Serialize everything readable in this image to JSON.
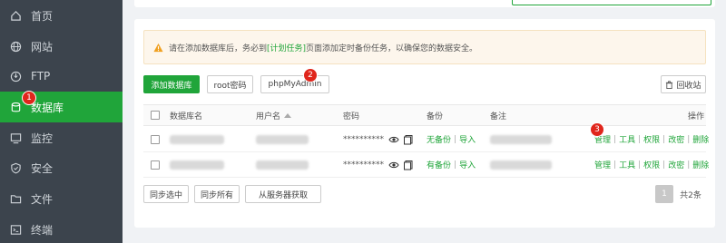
{
  "sidebar": {
    "items": [
      {
        "label": "首页",
        "icon": "home-icon"
      },
      {
        "label": "网站",
        "icon": "globe-icon"
      },
      {
        "label": "FTP",
        "icon": "ftp-icon"
      },
      {
        "label": "数据库",
        "icon": "database-icon",
        "active": true,
        "badge": "1"
      },
      {
        "label": "监控",
        "icon": "monitor-icon"
      },
      {
        "label": "安全",
        "icon": "shield-icon"
      },
      {
        "label": "文件",
        "icon": "folder-icon"
      },
      {
        "label": "终端",
        "icon": "terminal-icon"
      }
    ]
  },
  "notice": {
    "prefix": "请在添加数据库后，务必到",
    "link": "[计划任务]",
    "suffix": "页面添加定时备份任务，以确保您的数据安全。"
  },
  "toolbar": {
    "add_db": "添加数据库",
    "root_pwd": "root密码",
    "phpmyadmin": "phpMyAdmin",
    "phpmyadmin_badge": "2",
    "recycle_bin": "回收站"
  },
  "table": {
    "headers": {
      "name": "数据库名",
      "user": "用户名",
      "password": "密码",
      "backup": "备份",
      "note": "备注",
      "actions": "操作"
    },
    "rows": [
      {
        "password": "**********",
        "backup_status": "无备份",
        "import": "导入",
        "actions": [
          "管理",
          "工具",
          "权限",
          "改密",
          "删除"
        ],
        "badge": "3"
      },
      {
        "password": "**********",
        "backup_status": "有备份",
        "import": "导入",
        "actions": [
          "管理",
          "工具",
          "权限",
          "改密",
          "删除"
        ]
      }
    ]
  },
  "footer": {
    "sync_selected": "同步选中",
    "sync_all": "同步所有",
    "fetch_server": "从服务器获取",
    "current_page": "1",
    "total": "共2条"
  },
  "colors": {
    "accent": "#20a53a",
    "sidebar": "#3c444d",
    "badge": "#e0261c"
  }
}
